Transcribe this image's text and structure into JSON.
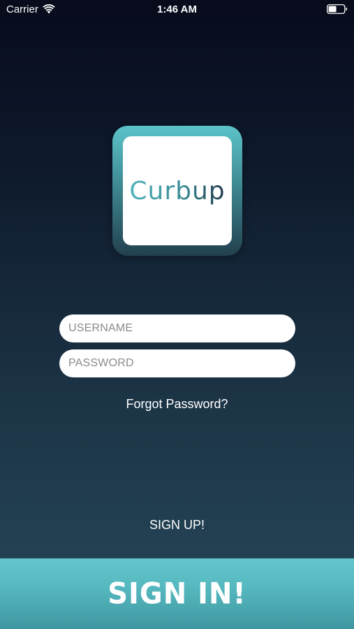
{
  "status_bar": {
    "carrier": "Carrier",
    "time": "1:46 AM"
  },
  "logo": {
    "brand_text": "Curbup",
    "colors": {
      "teal": "#4aa8b0",
      "navy": "#1f3a4e"
    }
  },
  "login_form": {
    "username_placeholder": "USERNAME",
    "password_placeholder": "PASSWORD",
    "forgot_label": "Forgot Password?",
    "signup_label": "SIGN UP!",
    "signin_label": "SIGN IN!"
  },
  "icons": {
    "wifi": "wifi-icon",
    "battery": "battery-icon"
  }
}
